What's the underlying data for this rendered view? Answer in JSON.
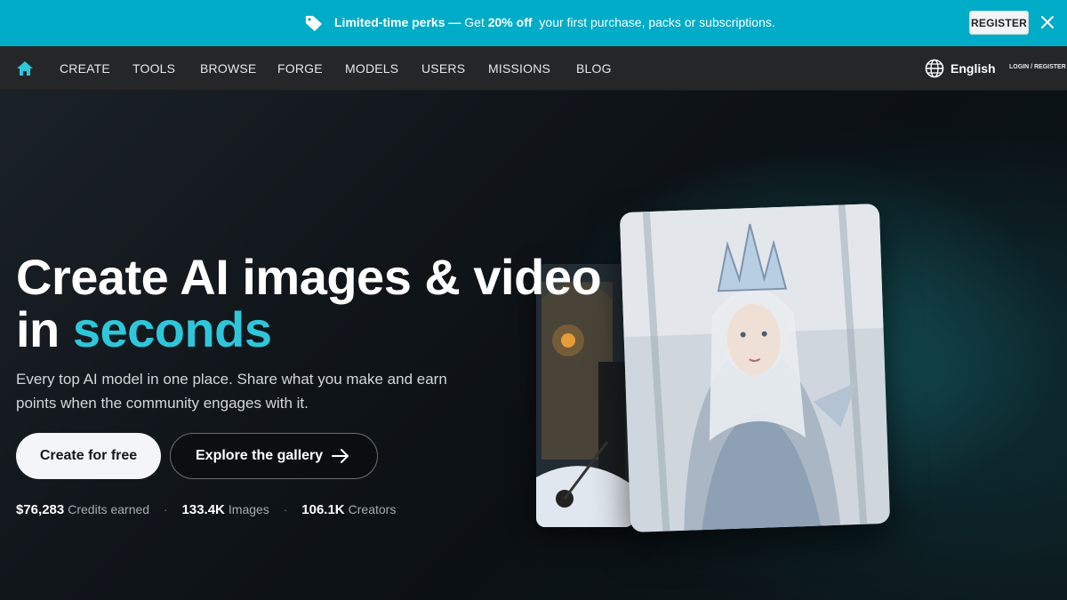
{
  "promo": {
    "strong_text": "Limited-time perks — ",
    "get_text": "Get ",
    "discount": "20% off",
    "rest_text": "your first purchase, packs or subscriptions.",
    "register_label": "REGISTER",
    "icon": "tag-icon",
    "close_icon": "close-icon",
    "bg_color": "#00acc8"
  },
  "nav": {
    "home_icon": "home-icon",
    "items": [
      {
        "label": "CREATE"
      },
      {
        "label": "TOOLS"
      },
      {
        "label": "BROWSE"
      },
      {
        "label": "FORGE"
      },
      {
        "label": "MODELS"
      },
      {
        "label": "USERS"
      },
      {
        "label": "MISSIONS"
      },
      {
        "label": "BLOG"
      }
    ],
    "language": "English",
    "login_register": "LOGIN / REGISTER",
    "accent_color": "#2ec7da"
  },
  "hero": {
    "title_line1": "Create AI images & video",
    "title_line2_prefix": "in ",
    "title_accent": "seconds",
    "subtitle": "Every top AI model in one place. Share what you make and earn points when the community engages with it.",
    "primary_button": "Create for free",
    "secondary_button": "Explore the gallery",
    "stats": [
      {
        "value": "$76,283",
        "label": "Credits earned"
      },
      {
        "value": "133.4K",
        "label": "Images"
      },
      {
        "value": "106.1K",
        "label": "Creators"
      }
    ]
  }
}
